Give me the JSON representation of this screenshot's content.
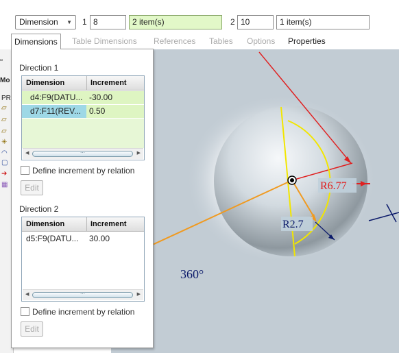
{
  "toolbar": {
    "type_combo": "Dimension",
    "direction1_label": "1",
    "direction1_count": "8",
    "direction1_refs": "2 item(s)",
    "direction2_label": "2",
    "direction2_count": "10",
    "direction2_refs": "1 item(s)"
  },
  "tabs": [
    "Dimensions",
    "Table Dimensions",
    "References",
    "Tables",
    "Options",
    "Properties"
  ],
  "tree": {
    "mod": "Mo",
    "prt": "PR"
  },
  "panel": {
    "direction1": {
      "title": "Direction 1",
      "headers": [
        "Dimension",
        "Increment"
      ],
      "rows": [
        {
          "dimension": "d4:F9(DATU...",
          "increment": "-30.00"
        },
        {
          "dimension": "d7:F11(REV...",
          "increment": "0.50"
        }
      ],
      "checkbox_label": "Define increment by relation",
      "edit_label": "Edit"
    },
    "direction2": {
      "title": "Direction 2",
      "headers": [
        "Dimension",
        "Increment"
      ],
      "rows": [
        {
          "dimension": "d5:F9(DATU...",
          "increment": "30.00"
        }
      ],
      "checkbox_label": "Define increment by relation",
      "edit_label": "Edit"
    }
  },
  "viewport": {
    "dim_r1": "R6.77",
    "dim_r2": "R2.7",
    "dim_angle": "360°",
    "colors": {
      "background": "#c2ccd4",
      "red": "#e02020",
      "yellow": "#f2e600",
      "orange": "#f09a20",
      "navy": "#0b1a6a"
    }
  }
}
